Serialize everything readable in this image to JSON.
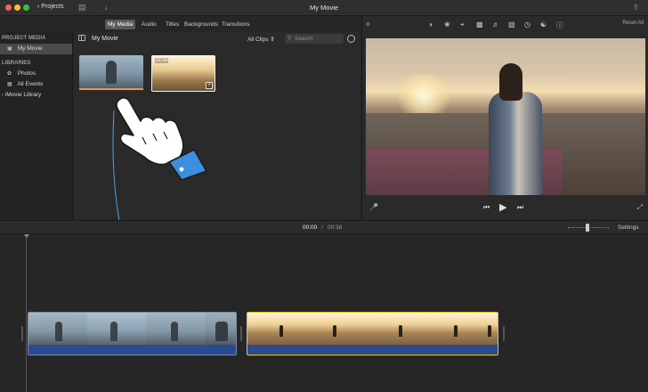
{
  "window": {
    "title": "My Movie",
    "projects_label": "Projects"
  },
  "media_tabs": {
    "items": [
      "My Media",
      "Audio",
      "Titles",
      "Backgrounds",
      "Transitions"
    ],
    "selected": "My Media"
  },
  "sidebar": {
    "project_media_heading": "PROJECT MEDIA",
    "project_item": "My Movie",
    "libraries_heading": "LIBRARIES",
    "library_items": [
      "Photos",
      "All Events"
    ],
    "library_root": "iMovie Library"
  },
  "browser": {
    "title": "My Movie",
    "filter_label": "All Clips",
    "search_placeholder": "Search",
    "clips": [
      {
        "duration_label": "",
        "selected": false
      },
      {
        "duration_label": "21.0s",
        "selected": true
      }
    ]
  },
  "viewer": {
    "reset_label": "Reset All",
    "tools": [
      "magic-wand-icon",
      "color-balance-icon",
      "color-palette-icon",
      "crop-icon",
      "stabilization-icon",
      "volume-icon",
      "equalizer-icon",
      "speed-icon",
      "filter-icon",
      "info-icon"
    ]
  },
  "timeline": {
    "current_time": "00:00",
    "separator": "/",
    "total_time": "00:38",
    "settings_label": "Settings"
  },
  "colors": {
    "selection_orange": "#f09a1e",
    "selected_clip_yellow": "#e7c33c",
    "audio_blue": "#2b4b91",
    "drag_arrow_blue": "#4aa3e8",
    "hand_cuff_blue": "#3d8de0"
  }
}
